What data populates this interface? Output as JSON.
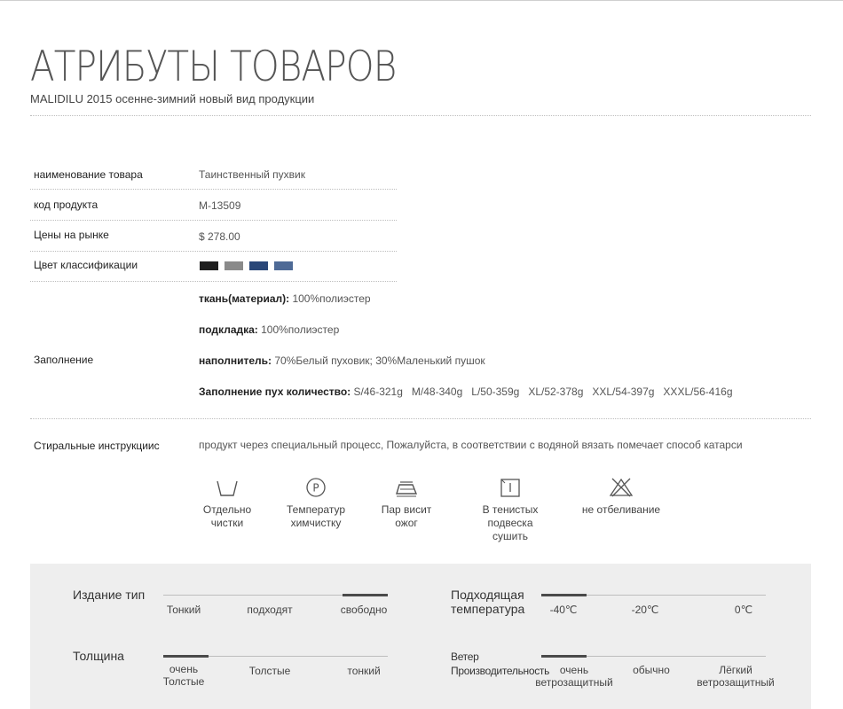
{
  "header": {
    "title": "АТРИБУТЫ ТОВАРОВ",
    "subtitle": "MALIDILU 2015 осенне-зимний новый вид продукции"
  },
  "attributes": {
    "name_label": "наименование товара",
    "name_value": "Таинственный пухвик",
    "code_label": "код продукта",
    "code_value": "M-13509",
    "price_label": "Цены на рынке",
    "price_value": "$ 278.00",
    "color_label": "Цвет классификации",
    "colors": [
      "#1f1f1f",
      "#8a8a8a",
      "#2a4778",
      "#4e6a96"
    ],
    "filling_label": "Заполнение",
    "filling": [
      {
        "label": "ткань(материал):",
        "value": " 100%полиэстер"
      },
      {
        "label": "подкладка:",
        "value": " 100%полиэстер"
      },
      {
        "label": "наполнитель:",
        "value": " 70%Белый пуховик; 30%Маленький пушок"
      },
      {
        "label": "Заполнение пух количество:",
        "value": " S/46-321g   M/48-340g   L/50-359g   XL/52-378g   XXL/54-397g   XXXL/56-416g"
      }
    ],
    "wash_label": "Стиральные инструкциис",
    "wash_value": "продукт через специальный процесс, Пожалуйста, в соответствии с водяной вязать  помечает способ катарси"
  },
  "care": [
    {
      "icon": "wash-tub-icon",
      "line1": "Отдельно",
      "line2": "чистки"
    },
    {
      "icon": "dry-clean-p-icon",
      "line1": "Температур",
      "line2": "химчистку"
    },
    {
      "icon": "iron-icon",
      "line1": "Пар висит",
      "line2": "ожог"
    },
    {
      "icon": "shade-dry-icon",
      "line1": "В тенистых",
      "line2": "подвеска сушить"
    },
    {
      "icon": "no-bleach-icon",
      "line1": "не  отбеливание",
      "line2": ""
    }
  ],
  "specs": {
    "fit": {
      "title": "Издание тип",
      "options": [
        "Тонкий",
        "подходят",
        "свободно"
      ],
      "selected_index": 2
    },
    "temperature": {
      "title_line1": "Подходящая",
      "title_line2": "температура",
      "options": [
        "-40℃",
        "-20℃",
        "0℃"
      ],
      "selected_index": 0
    },
    "thickness": {
      "title": "Толщина",
      "options": [
        {
          "line1": "очень",
          "line2": "Толстые"
        },
        {
          "line1": "Толстые",
          "line2": ""
        },
        {
          "line1": "тонкий",
          "line2": ""
        }
      ],
      "selected_index": 0
    },
    "wind": {
      "title_line1": "Ветер",
      "title_line2": "Производительность",
      "options": [
        {
          "line1": "очень",
          "line2": "ветрозащитный"
        },
        {
          "line1": "обычно",
          "line2": ""
        },
        {
          "line1": "Лёгкий",
          "line2": "ветрозащитный"
        }
      ],
      "selected_index": 0
    }
  }
}
